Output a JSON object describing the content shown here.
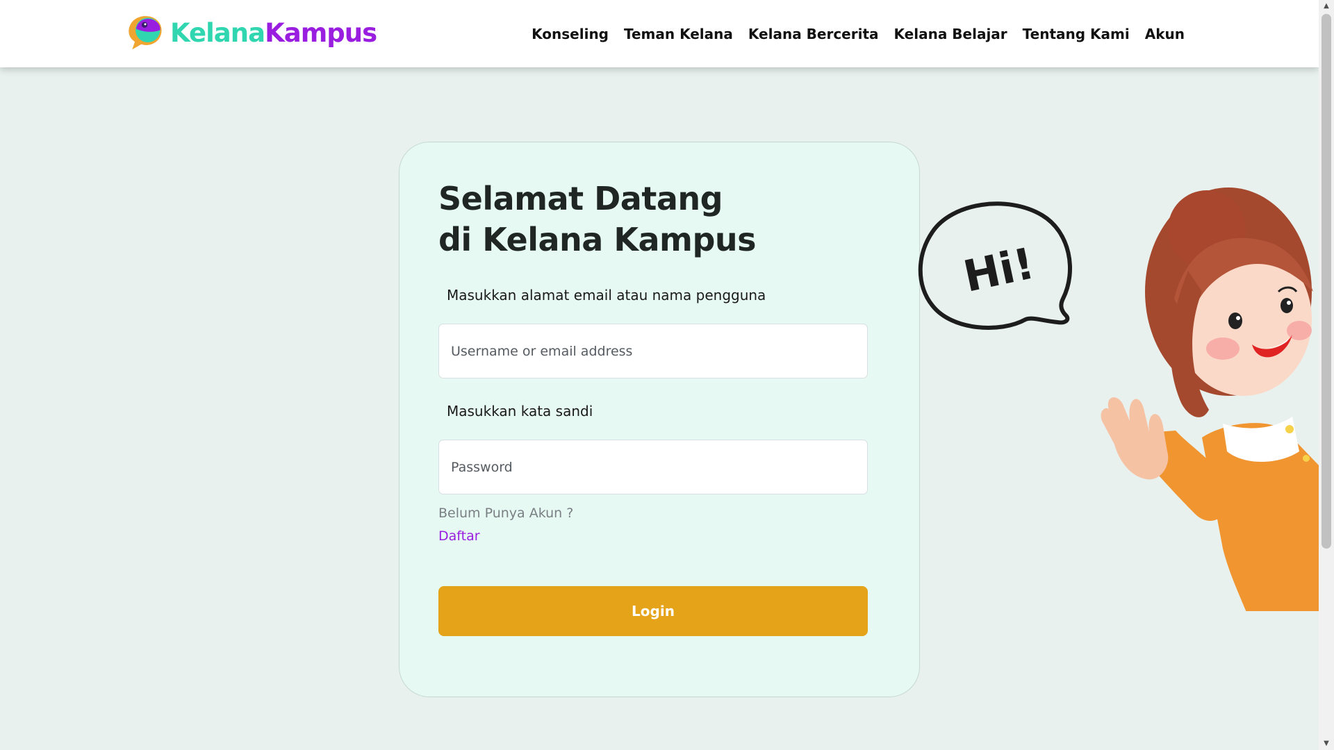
{
  "brand": {
    "name_part1": "Kelana",
    "name_part2": "Kampus",
    "logo_icon": "chat-bubble-logo-icon",
    "colors": {
      "part1": "#2fd6b0",
      "part2": "#9a1ee0"
    }
  },
  "nav": {
    "items": [
      {
        "label": "Konseling"
      },
      {
        "label": "Teman Kelana"
      },
      {
        "label": "Kelana Bercerita"
      },
      {
        "label": "Kelana Belajar"
      },
      {
        "label": "Tentang Kami"
      },
      {
        "label": "Akun"
      }
    ]
  },
  "login": {
    "title": "Selamat Datang di Kelana Kampus",
    "email_label": "Masukkan alamat email atau nama pengguna",
    "email_placeholder": "Username or email address",
    "email_value": "",
    "password_label": "Masukkan kata sandi",
    "password_placeholder": "Password",
    "password_value": "",
    "no_account_text": "Belum Punya Akun ?",
    "register_link": "Daftar",
    "login_button": "Login"
  },
  "illustration": {
    "speech_text": "Hi!",
    "icon": "waving-girl-illustration"
  },
  "colors": {
    "page_background": "#e8f1ee",
    "card_background": "#e6f9f3",
    "button": "#e5a319",
    "link": "#9a1ee0"
  }
}
